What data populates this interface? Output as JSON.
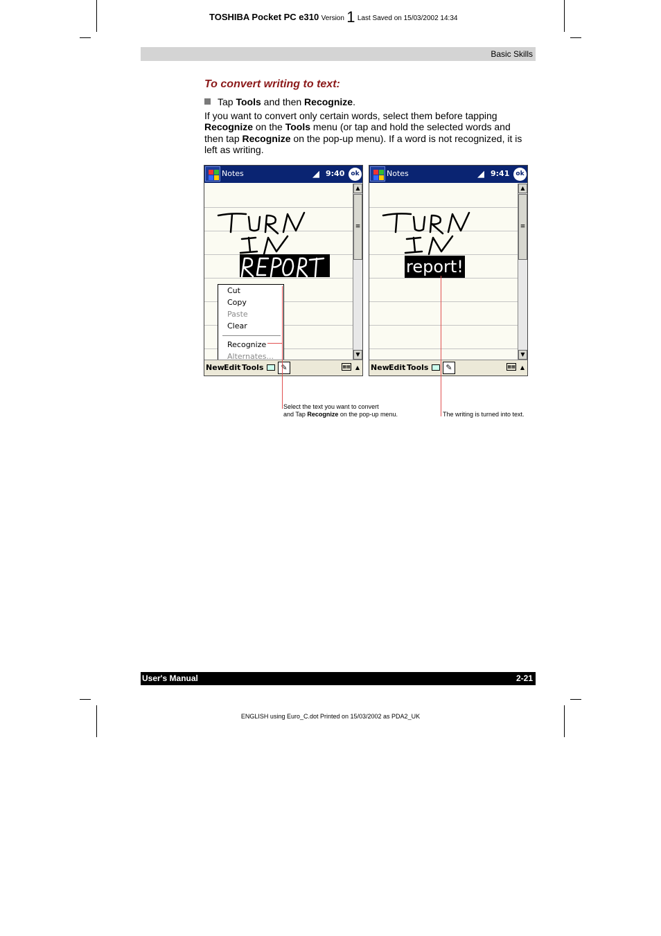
{
  "header": {
    "product": "TOSHIBA Pocket PC e310",
    "version_label": "Version",
    "version_number": "1",
    "last_saved": "Last Saved on 15/03/2002 14:34"
  },
  "section_label": "Basic Skills",
  "heading": "To convert writing to text:",
  "bullet": {
    "pre": "Tap ",
    "b1": "Tools",
    "mid": " and then ",
    "b2": "Recognize",
    "post": "."
  },
  "paragraph": {
    "t1": "If you want to convert only certain words, select them before tapping ",
    "b1": "Recognize",
    "t2": " on the ",
    "b2": "Tools",
    "t3": " menu (or tap and hold the selected words and then tap ",
    "b3": "Recognize",
    "t4": " on the pop-up menu). If a word is not recognized, it is left as writing."
  },
  "screen_left": {
    "title": "Notes",
    "time": "9:40",
    "ok": "ok",
    "menu": [
      "New",
      "Edit",
      "Tools"
    ],
    "popup": {
      "cut": "Cut",
      "copy": "Copy",
      "paste": "Paste",
      "clear": "Clear",
      "recognize": "Recognize",
      "alternates": "Alternates..."
    }
  },
  "screen_right": {
    "title": "Notes",
    "time": "9:41",
    "ok": "ok",
    "menu": [
      "New",
      "Edit",
      "Tools"
    ],
    "recognized_word": "report!"
  },
  "captions": {
    "left_line1": "Select the text you want to convert",
    "left_line2_pre": "and Tap ",
    "left_line2_bold": "Recognize",
    "left_line2_post": " on the pop-up menu.",
    "right": "The writing is turned into text."
  },
  "footer": {
    "left": "User's Manual",
    "right": "2-21",
    "print_info": "ENGLISH using Euro_C.dot  Printed on 15/03/2002 as PDA2_UK"
  },
  "colors": {
    "heading": "#8b1a1a",
    "titlebar": "#0a2472",
    "callout": "#e05050",
    "section_bar": "#d4d4d4"
  }
}
